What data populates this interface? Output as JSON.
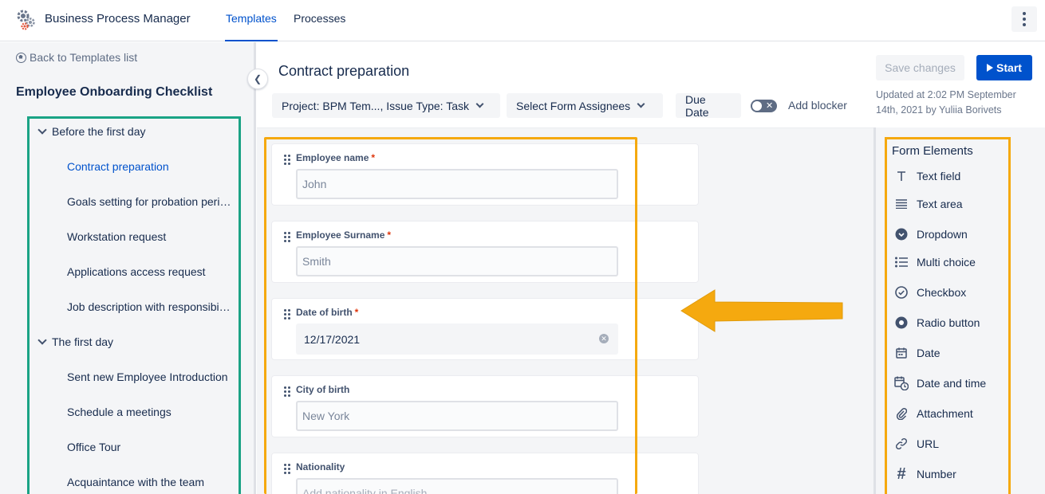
{
  "app": {
    "title": "Business Process Manager"
  },
  "nav": {
    "tabs": [
      {
        "label": "Templates",
        "active": true
      },
      {
        "label": "Processes",
        "active": false
      }
    ]
  },
  "sidebar": {
    "back_label": "Back to Templates list",
    "template_title": "Employee Onboarding Checklist",
    "groups": [
      {
        "label": "Before the first day",
        "items": [
          {
            "label": "Contract preparation",
            "active": true
          },
          {
            "label": "Goals setting for probation period"
          },
          {
            "label": "Workstation request"
          },
          {
            "label": "Applications access request"
          },
          {
            "label": "Job description with responsibilities"
          }
        ]
      },
      {
        "label": "The first day",
        "items": [
          {
            "label": "Sent new Employee Introduction"
          },
          {
            "label": "Schedule a meetings"
          },
          {
            "label": "Office Tour"
          },
          {
            "label": "Acquaintance with the team"
          }
        ]
      }
    ]
  },
  "task": {
    "title": "Contract preparation",
    "project_chip": "Project: BPM Tem..., Issue Type: Task",
    "assignees_chip": "Select Form Assignees",
    "due_date_chip": "Due Date",
    "blocker_label": "Add blocker",
    "blocker_enabled": false
  },
  "actions": {
    "save_label": "Save changes",
    "start_label": "Start",
    "updated_text": "Updated at 2:02 PM September 14th, 2021 by Yuliia Borivets"
  },
  "form_fields": [
    {
      "label": "Employee name",
      "required": true,
      "value": "John"
    },
    {
      "label": "Employee Surname",
      "required": true,
      "value": "Smith"
    },
    {
      "label": "Date of birth",
      "required": true,
      "value": "12/17/2021"
    },
    {
      "label": "City of birth",
      "required": false,
      "value": "New York"
    },
    {
      "label": "Nationality",
      "required": false,
      "placeholder": "Add nationality in English"
    }
  ],
  "elements_panel": {
    "title": "Form Elements",
    "items": [
      {
        "label": "Text field",
        "icon": "text-field-icon"
      },
      {
        "label": "Text area",
        "icon": "text-area-icon"
      },
      {
        "label": "Dropdown",
        "icon": "dropdown-icon"
      },
      {
        "label": "Multi choice",
        "icon": "multi-choice-icon"
      },
      {
        "label": "Checkbox",
        "icon": "checkbox-icon"
      },
      {
        "label": "Radio button",
        "icon": "radio-button-icon"
      },
      {
        "label": "Date",
        "icon": "calendar-icon"
      },
      {
        "label": "Date and time",
        "icon": "calendar-clock-icon"
      },
      {
        "label": "Attachment",
        "icon": "paperclip-icon"
      },
      {
        "label": "URL",
        "icon": "link-icon"
      },
      {
        "label": "Number",
        "icon": "hash-icon"
      }
    ]
  },
  "colors": {
    "accent": "#0052cc",
    "highlight_orange": "#f5a90f",
    "highlight_teal": "#1aa385"
  }
}
